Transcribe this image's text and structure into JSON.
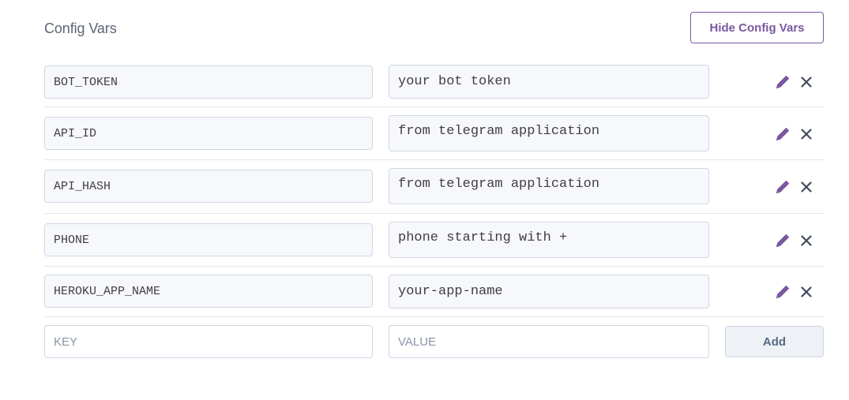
{
  "header": {
    "title": "Config Vars",
    "hide_button_label": "Hide Config Vars"
  },
  "config_vars": [
    {
      "key": "BOT_TOKEN",
      "value": "your bot token"
    },
    {
      "key": "API_ID",
      "value": "from telegram application"
    },
    {
      "key": "API_HASH",
      "value": "from telegram application"
    },
    {
      "key": "PHONE",
      "value": "phone starting with +"
    },
    {
      "key": "HEROKU_APP_NAME",
      "value": "your-app-name"
    }
  ],
  "new_var": {
    "key_placeholder": "KEY",
    "value_placeholder": "VALUE",
    "add_label": "Add"
  },
  "icons": {
    "edit": "pencil-icon",
    "delete": "close-icon"
  },
  "colors": {
    "accent": "#79589f",
    "icon_delete": "#3f4a5a",
    "field_border": "#cfd7e6",
    "field_bg": "#f7f8fb"
  }
}
